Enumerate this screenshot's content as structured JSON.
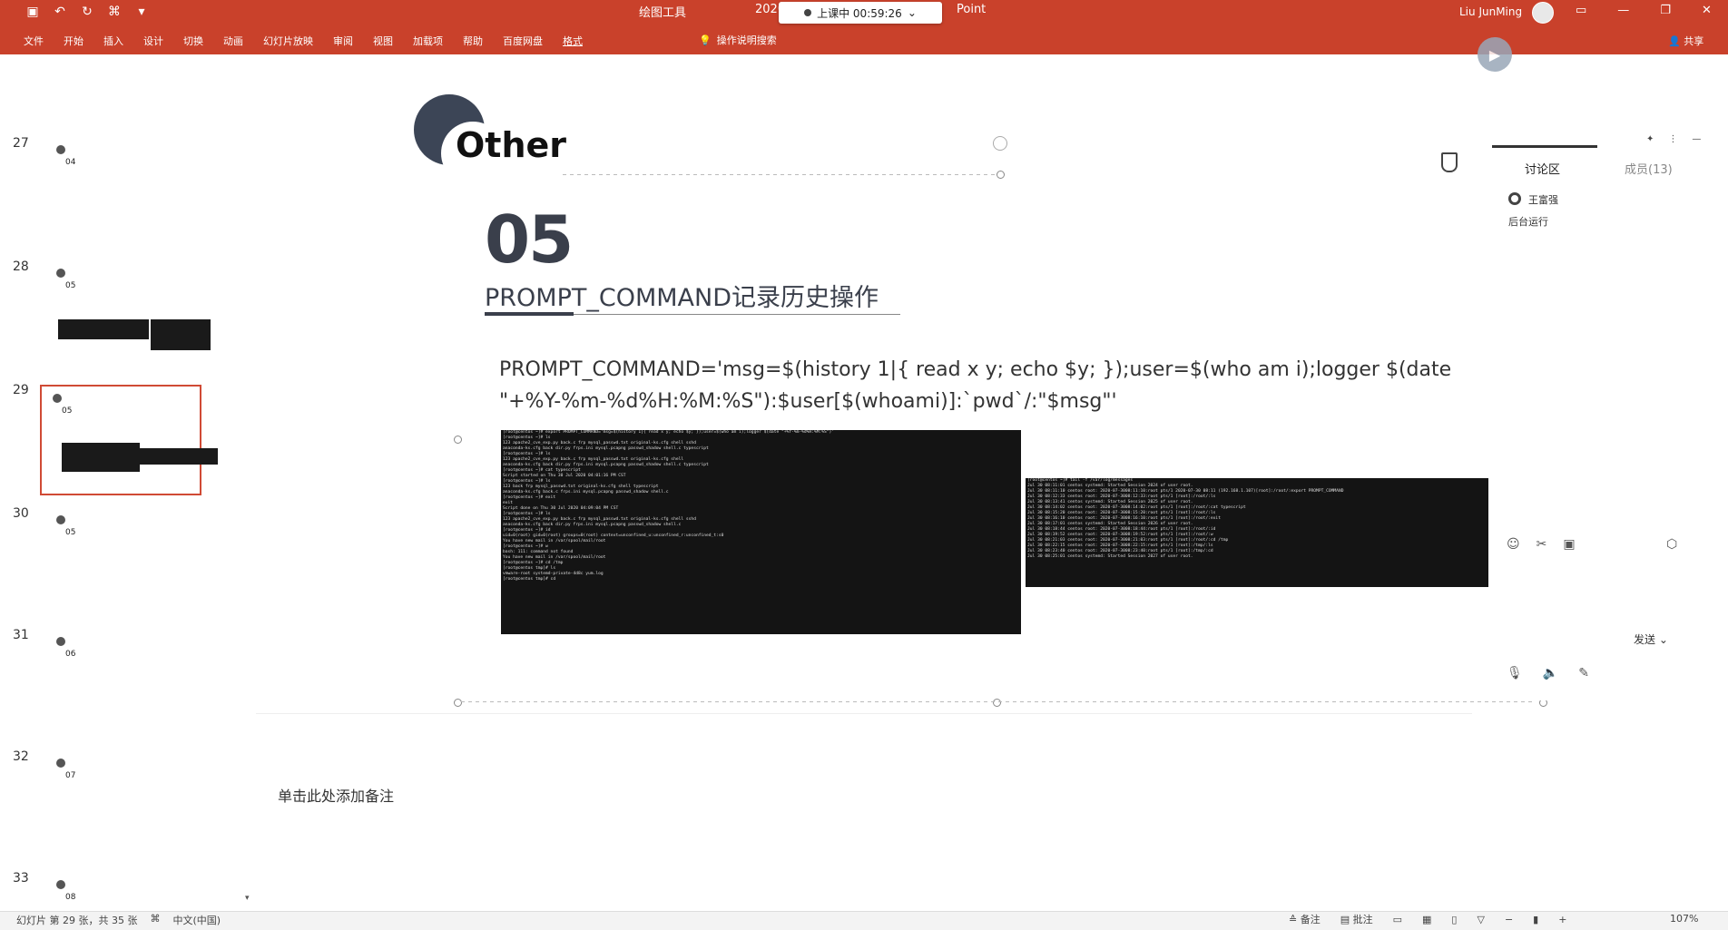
{
  "ribbon": {
    "context_tool": "绘图工具",
    "context_year": "2020",
    "app_name_fragment": "Point",
    "live_status": "上课中 00:59:26",
    "user_name": "Liu JunMing",
    "menu": [
      "文件",
      "开始",
      "插入",
      "设计",
      "切换",
      "动画",
      "幻灯片放映",
      "审阅",
      "视图",
      "加载项",
      "帮助",
      "百度网盘",
      "格式"
    ],
    "active_menu": "格式",
    "search_label": "操作说明搜索",
    "share_label": "共享"
  },
  "thumbnails": [
    {
      "num": "27",
      "label": "04"
    },
    {
      "num": "28",
      "label": "05"
    },
    {
      "num": "29",
      "label": "05"
    },
    {
      "num": "30",
      "label": "05"
    },
    {
      "num": "31",
      "label": "06"
    },
    {
      "num": "32",
      "label": "07"
    },
    {
      "num": "33",
      "label": "08"
    }
  ],
  "slide": {
    "section": "Other",
    "number": "05",
    "subtitle": "PROMPT_COMMAND记录历史操作",
    "code": "PROMPT_COMMAND='msg=$(history 1|{ read x y; echo $y; });user=$(who am i);logger $(date \"+%Y-%m-%d%H:%M:%S\"):$user[$(whoami)]:`pwd`/:\"$msg\"'"
  },
  "terminal1": [
    "[root@centos ~]# export PROMPT_COMMAND='msg=$(history 1|{ read x y; echo $y; });user=$(who am i);logger $(date \"+%Y-%m-%d%H:%M:%S\")'",
    "[root@centos ~]# ls",
    "123    apache2_cve_exp.py  back.c   frp    mysql_passwd.txt  original-ks.cfg  shell   sshd",
    "anaconda-ks.cfg  back   dir.py   frps.ini  mysql.pcapng  passwd_shadow  shell.c  typescript",
    "[root@centos ~]# ls",
    "123    apache2_cve_exp.py  back.c   frp    mysql_passwd.txt  original-ks.cfg  shell",
    "anaconda-ks.cfg  back   dir.py   frps.ini  mysql.pcapng  passwd_shadow  shell.c  typescript",
    "[root@centos ~]# cat typescript",
    "Script started on Thu 30 Jul 2020 04:01:16 PM CST",
    "[root@centos ~]# ls",
    "123    back   frp   mysql_passwd.txt  original-ks.cfg  shell   typescript",
    "anaconda-ks.cfg  back.c  frps.ini  mysql.pcapng  passwd_shadow  shell.c",
    "[root@centos ~]# exit",
    "exit",
    "",
    "Script done on Thu 30 Jul 2020 04:09:04 PM CST",
    "[root@centos ~]# ls",
    "123    apache2_cve_exp.py  back.c  frp   mysql_passwd.txt  original-ks.cfg  shell   sshd",
    "anaconda-ks.cfg  back   dir.py  frps.ini  mysql.pcapng  passwd_shadow  shell.c",
    "[root@centos ~]# id",
    "uid=0(root) gid=0(root) groups=0(root) context=unconfined_u:unconfined_r:unconfined_t:s0",
    "You have new mail in /var/spool/mail/root",
    "[root@centos ~]# w",
    "bash: 111: command not found",
    "You have new mail in /var/spool/mail/root",
    "[root@centos ~]# cd /tmp",
    "[root@centos tmp]# ls",
    "vmware-root  systemd-private-4d8c  yum.log",
    "[root@centos tmp]# cd"
  ],
  "terminal2": [
    "[root@centos ~]# tail -f /var/log/messages",
    "Jul 30 08:11:01 centos systemd: Started Session 2024 of user root.",
    "Jul 30 08:11:10 centos root: 2020-07-3008:11:10:root pts/1 2020-07-30 08:11 (192.168.1.107)[root]:/root/:export PROMPT_COMMAND",
    "Jul 30 08:12:33 centos root: 2020-07-3008:12:33:root pts/1 [root]:/root/:ls",
    "Jul 30 08:13:41 centos systemd: Started Session 2025 of user root.",
    "Jul 30 08:14:02 centos root: 2020-07-3008:14:02:root pts/1 [root]:/root/:cat typescript",
    "Jul 30 08:15:20 centos root: 2020-07-3008:15:20:root pts/1 [root]:/root/:ls",
    "Jul 30 08:16:10 centos root: 2020-07-3008:16:10:root pts/1 [root]:/root/:exit",
    "Jul 30 08:17:01 centos systemd: Started Session 2026 of user root.",
    "Jul 30 08:18:44 centos root: 2020-07-3008:18:44:root pts/1 [root]:/root/:id",
    "Jul 30 08:19:52 centos root: 2020-07-3008:19:52:root pts/1 [root]:/root/:w",
    "Jul 30 08:21:03 centos root: 2020-07-3008:21:03:root pts/1 [root]:/root/:cd /tmp",
    "Jul 30 08:22:15 centos root: 2020-07-3008:22:15:root pts/1 [root]:/tmp/:ls",
    "Jul 30 08:23:40 centos root: 2020-07-3008:23:40:root pts/1 [root]:/tmp/:cd",
    "Jul 30 08:25:01 centos systemd: Started Session 2027 of user root."
  ],
  "notes": {
    "placeholder": "单击此处添加备注"
  },
  "panel": {
    "tab_discussion": "讨论区",
    "tab_members": "成员(13)",
    "msg_user": "王富强",
    "msg_text": "后台运行",
    "send_label": "发送"
  },
  "status": {
    "slide_info": "幻灯片 第 29 张，共 35 张",
    "language": "中文(中国)",
    "notes_btn": "备注",
    "comments_btn": "批注",
    "zoom": "107%"
  }
}
